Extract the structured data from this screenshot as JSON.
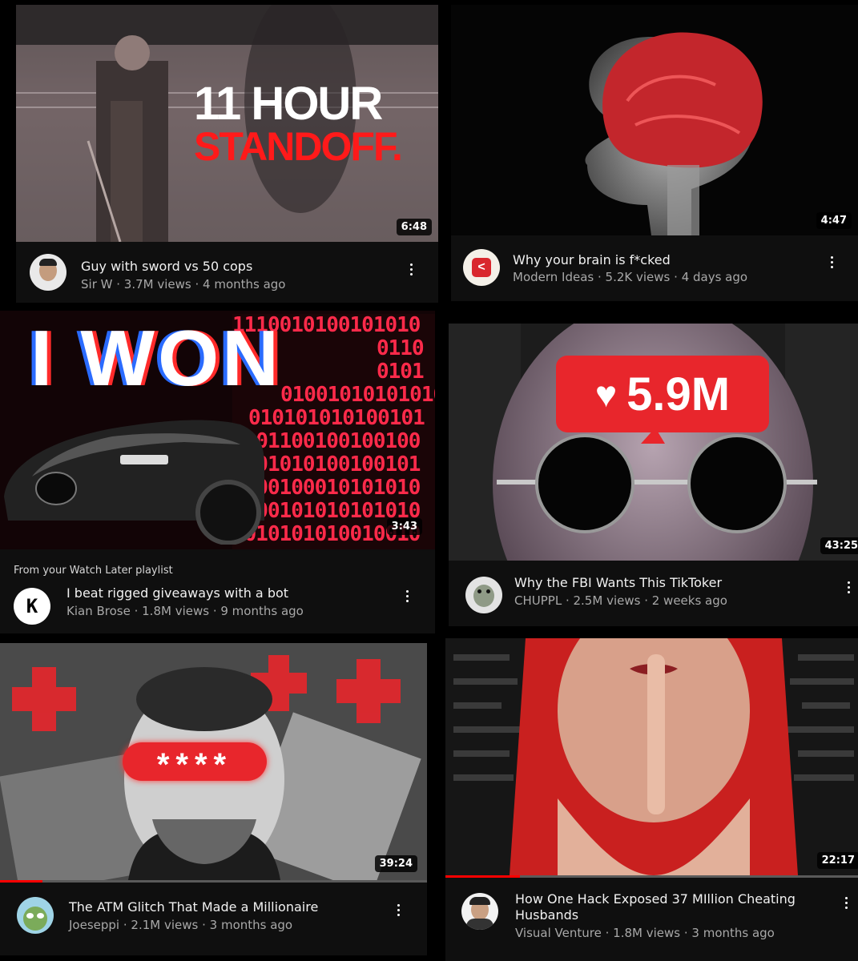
{
  "videos": [
    {
      "title": "Guy with sword vs 50 cops",
      "channel": "Sir W",
      "views": "3.7M views",
      "age": "4 months ago",
      "duration": "6:48",
      "thumb_text_line1": "11 HOUR",
      "thumb_text_line2": "STANDOFF."
    },
    {
      "title": "Why your brain is f*cked",
      "channel": "Modern Ideas",
      "views": "5.2K views",
      "age": "4 days ago",
      "duration": "4:47",
      "avatar_glyph": "<"
    },
    {
      "playlist_note": "From your Watch Later playlist",
      "title": "I beat rigged giveaways with a bot",
      "channel": "Kian Brose",
      "views": "1.8M views",
      "age": "9 months ago",
      "duration": "3:43",
      "thumb_text": "I WON",
      "binary_lines": [
        "1110010100101010",
        "0110",
        "0101",
        "01001010101010",
        "010101010100101",
        "0101100100100100",
        "0101010100100101",
        "0100100010101010",
        "0100101010101010",
        "1010101010010010"
      ],
      "avatar_glyph": "K"
    },
    {
      "title": "Why the FBI Wants This TikToker",
      "channel": "CHUPPL",
      "views": "2.5M views",
      "age": "2 weeks ago",
      "duration": "43:25",
      "like_count": "5.9M"
    },
    {
      "title": "The ATM Glitch That Made a Millionaire",
      "channel": "Joeseppi",
      "views": "2.1M views",
      "age": "3 months ago",
      "duration": "39:24",
      "censor_text": "****",
      "progress": 0.1
    },
    {
      "title_line1": "How One Hack Exposed 37 MIllion Cheating",
      "title_line2": "Husbands",
      "channel": "Visual Venture",
      "views": "1.8M views",
      "age": "3 months ago",
      "duration": "22:17",
      "progress": 0.18
    }
  ],
  "separator": " · ",
  "colors": {
    "accent": "#ff0000",
    "card_bg": "#0f0f0f",
    "subtext": "#a8a8a8"
  },
  "icons": {
    "menu": "kebab-menu-icon",
    "heart": "heart-icon"
  }
}
